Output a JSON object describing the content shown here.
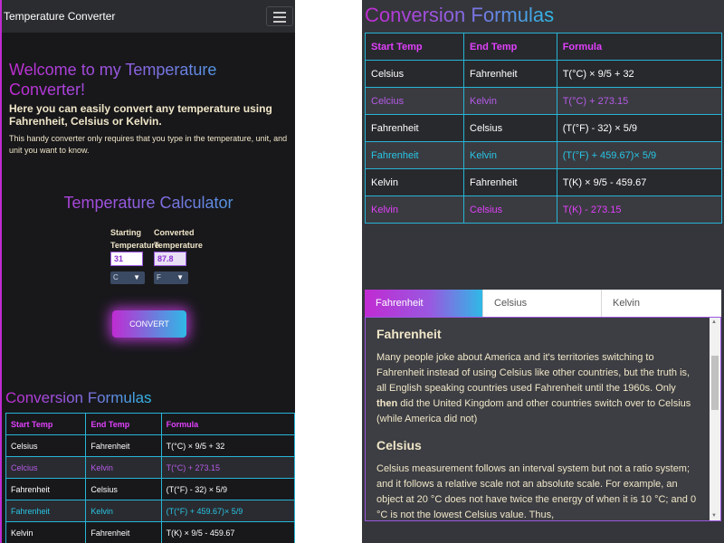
{
  "navbar": {
    "brand": "Temperature Converter"
  },
  "hero": {
    "title": "Welcome to my Temperature Converter!",
    "intro": "Here you can easily convert any temperature using Fahrenheit, Celsius or Kelvin.",
    "description": "This handy converter only requires that you type in the temperature, unit, and unit you want to know."
  },
  "calculator": {
    "title": "Temperature Calculator",
    "start_label": "Starting Temperature",
    "converted_label": "Converted Temperature",
    "start_value": "31",
    "converted_value": "87.8",
    "start_unit": "C",
    "converted_unit": "F",
    "convert_button": "CONVERT"
  },
  "formulas": {
    "title": "Conversion Formulas",
    "headers": [
      "Start Temp",
      "End Temp",
      "Formula"
    ],
    "rows": [
      [
        "Celsius",
        "Fahrenheit",
        "T(°C) × 9/5 + 32"
      ],
      [
        "Celcius",
        "Kelvin",
        "T(°C) + 273.15"
      ],
      [
        "Fahrenheit",
        "Celsius",
        "(T(°F) - 32) × 5/9"
      ],
      [
        "Fahrenheit",
        "Kelvin",
        "(T(°F) + 459.67)× 5/9"
      ],
      [
        "Kelvin",
        "Fahrenheit",
        "T(K) × 9/5 - 459.67"
      ],
      [
        "Kelvin",
        "Celsius",
        "T(K) - 273.15"
      ]
    ]
  },
  "tabs": {
    "items": [
      "Fahrenheit",
      "Celsius",
      "Kelvin"
    ],
    "active": "Fahrenheit",
    "content": {
      "h1": "Fahrenheit",
      "p1_before": "Many people joke about America and it's territories switching to Fahrenheit instead of using Celsius like other countries, but the truth is, all English speaking countries used Fahrenheit until the 1960s. Only ",
      "p1_bold": "then",
      "p1_after": " did the United Kingdom and other countries switch over to Celsius (while America did not)",
      "h2": "Celsius",
      "p2": "Celsius measurement follows an interval system but not a ratio system; and it follows a relative scale not an absolute scale. For example, an object at 20 °C does not have twice the energy of when it is 10 °C; and 0 °C is not the lowest Celsius value. Thus,"
    }
  },
  "colors": {
    "accent_pink": "#c02bd2",
    "accent_cyan": "#2fb9e6",
    "panel_bg": "#18181b",
    "text_cream": "#f0e6c8"
  }
}
